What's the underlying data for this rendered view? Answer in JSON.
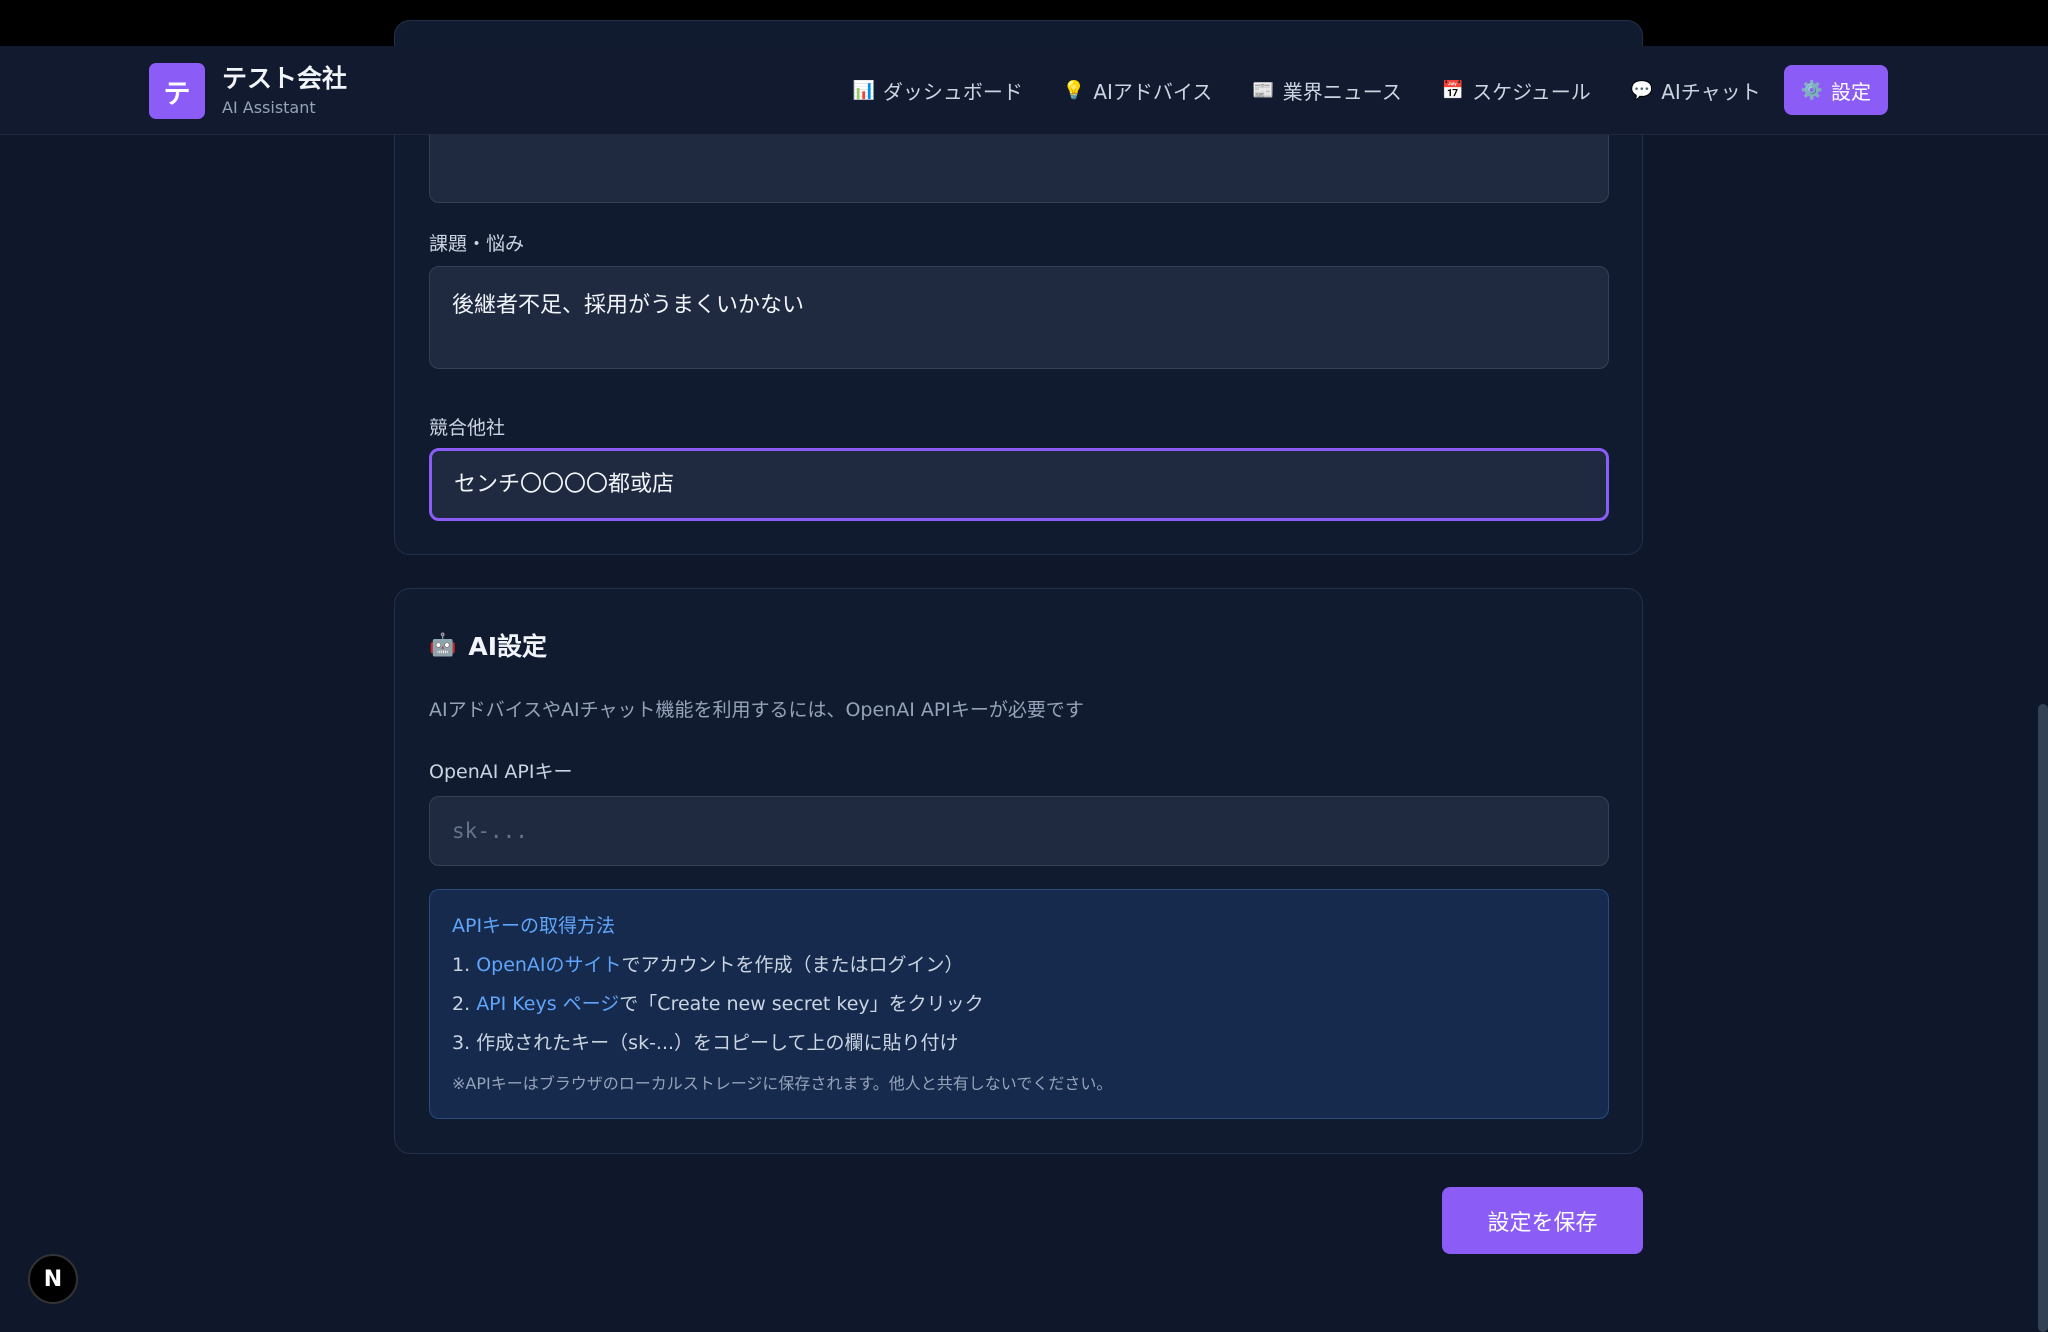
{
  "header": {
    "logo_letter": "テ",
    "company_name": "テスト会社",
    "subtitle": "AI Assistant"
  },
  "nav": [
    {
      "icon": "📊",
      "icon_name": "chart-icon",
      "label": "ダッシュボード"
    },
    {
      "icon": "💡",
      "icon_name": "lightbulb-icon",
      "label": "AIアドバイス"
    },
    {
      "icon": "📰",
      "icon_name": "newspaper-icon",
      "label": "業界ニュース"
    },
    {
      "icon": "📅",
      "icon_name": "calendar-icon",
      "label": "スケジュール"
    },
    {
      "icon": "💬",
      "icon_name": "chat-bubble-icon",
      "label": "AIチャット"
    },
    {
      "icon": "⚙️",
      "icon_name": "gear-icon",
      "label": "設定",
      "active": true
    }
  ],
  "company_form": {
    "issues": {
      "label": "課題・悩み",
      "value": "後継者不足、採用がうまくいかない"
    },
    "competitors": {
      "label": "競合他社",
      "value": "センチ〇〇〇〇都或店"
    }
  },
  "ai_settings": {
    "icon": "🤖",
    "icon_name": "robot-icon",
    "title": "AI設定",
    "description": "AIアドバイスやAIチャット機能を利用するには、OpenAI APIキーが必要です",
    "api_key_label": "OpenAI APIキー",
    "api_key_placeholder": "sk-...",
    "api_key_value": "",
    "help": {
      "title": "APIキーの取得方法",
      "step1_num": "1.",
      "step1_link": "OpenAIのサイト",
      "step1_text": "でアカウントを作成（またはログイン）",
      "step2_num": "2.",
      "step2_link": "API Keys ページ",
      "step2_text": "で「Create new secret key」をクリック",
      "step3": "3. 作成されたキー（sk-...）をコピーして上の欄に貼り付け",
      "note": "※APIキーはブラウザのローカルストレージに保存されます。他人と共有しないでください。"
    }
  },
  "save_button": "設定を保存",
  "dev_badge": "N",
  "colors": {
    "accent": "#8b5cf6",
    "link": "#60a5fa",
    "background": "#0f172a"
  }
}
